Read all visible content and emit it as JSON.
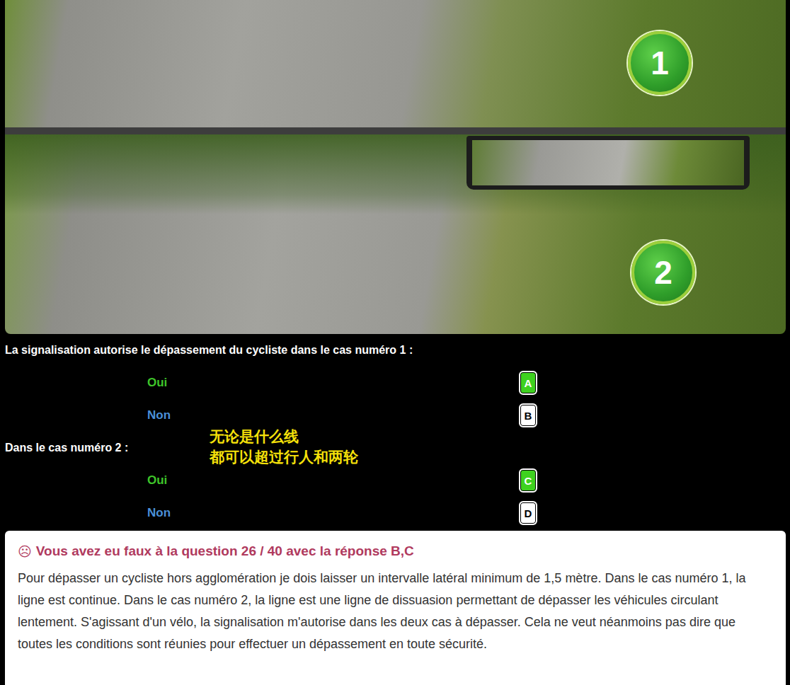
{
  "photos": [
    {
      "badge": "1"
    },
    {
      "badge": "2"
    }
  ],
  "questions": [
    {
      "text": "La signalisation autorise le dépassement du cycliste dans le cas numéro 1 :",
      "options": [
        {
          "label": "Oui",
          "key": "A",
          "highlighted": true,
          "color": "#3ec52a"
        },
        {
          "label": "Non",
          "key": "B",
          "highlighted": false,
          "color": "#4a8fd8"
        }
      ]
    },
    {
      "text": "Dans le cas numéro 2 :",
      "options": [
        {
          "label": "Oui",
          "key": "C",
          "highlighted": true,
          "color": "#3ec52a"
        },
        {
          "label": "Non",
          "key": "D",
          "highlighted": false,
          "color": "#4a8fd8"
        }
      ]
    }
  ],
  "annotation": {
    "lines": [
      "无论是什么线",
      "都可以超过行人和两轮"
    ]
  },
  "feedback": {
    "icon": "☹",
    "title": "Vous avez eu faux à la question 26 / 40 avec la réponse B,C",
    "text": "Pour dépasser un cycliste hors agglomération je dois laisser un intervalle latéral minimum de 1,5 mètre. Dans le cas numéro 1, la ligne est continue. Dans le cas numéro 2, la ligne est une ligne de dissuasion permettant de dépasser les véhicules circulant lentement. S'agissant d'un vélo, la signalisation m'autorise dans les deux cas à dépasser. Cela ne veut néanmoins pas dire que toutes les conditions sont réunies pour effectuer un dépassement en toute sécurité."
  }
}
